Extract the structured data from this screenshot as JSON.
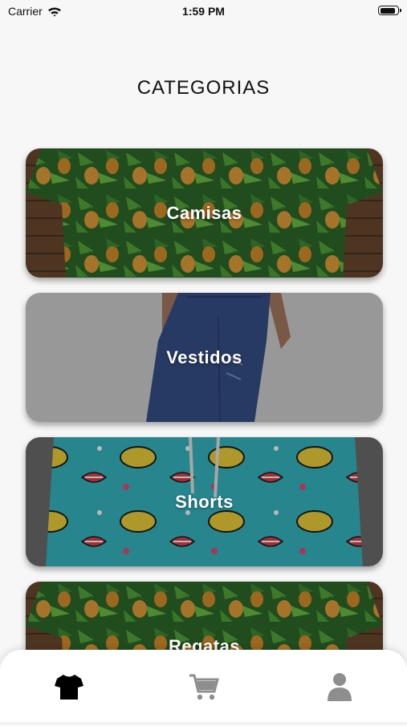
{
  "status_bar": {
    "carrier": "Carrier",
    "time": "1:59 PM",
    "battery_level": 0.9
  },
  "page": {
    "title": "CATEGORIAS"
  },
  "categories": [
    {
      "label": "Camisas"
    },
    {
      "label": "Vestidos"
    },
    {
      "label": "Shorts"
    },
    {
      "label": "Regatas"
    }
  ],
  "tab_bar": {
    "items": [
      {
        "icon": "tshirt-icon",
        "active": true
      },
      {
        "icon": "cart-icon",
        "active": false
      },
      {
        "icon": "user-icon",
        "active": false
      }
    ],
    "active_color": "#000000",
    "inactive_color": "#8e8e8e"
  }
}
